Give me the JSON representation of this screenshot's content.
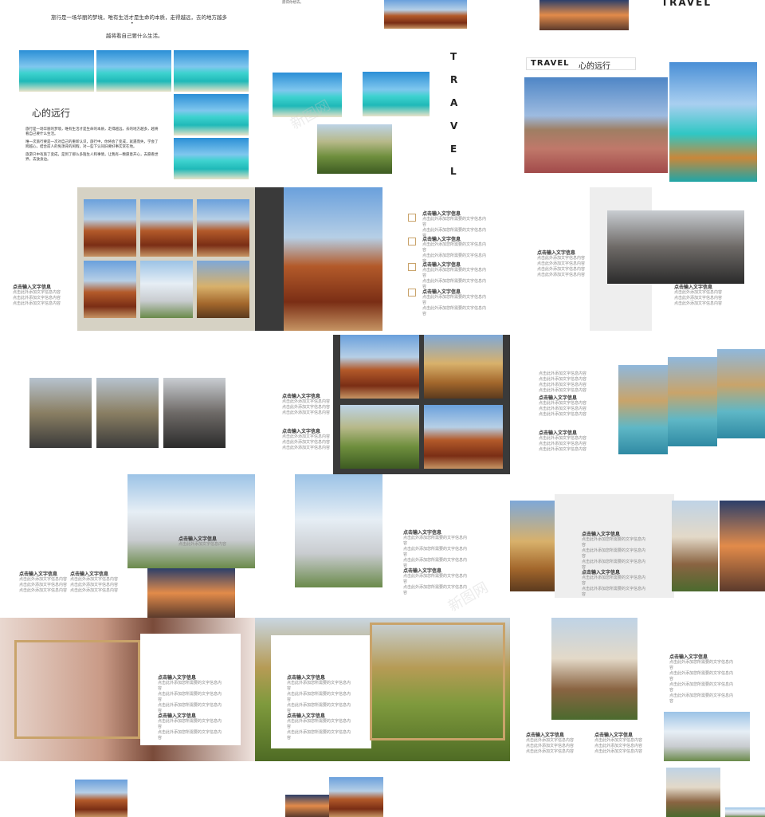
{
  "intro": {
    "line1": "旅行是一场华丽的梦境，唯有生活才是生命的本质，走得越远，去的地方越多",
    "bullet": "•",
    "line2": "越将看自己要什么生活。",
    "heading": "心的远行",
    "para1": "旅行是一场华丽的梦境，唯有生活才是生命的本质，走得越远，去的地方越多，越将看自己要什么生活。",
    "para2": "唯一次旅行要是一次对自己的重新认识，旅行中，你将会了变成，就遇而失，学会了跨越心，结合前人的免须背的闲暇，对一些下认同旧要好事实赏在地。",
    "para3": "旅游只中有旅了变成，是到了那么多陌生人和事情，让我有一颗愿意开心，去愿看世界，去放身边。"
  },
  "top_small_text": "愿得你想去。",
  "travel_word": "TRAVEL",
  "travel_vertical": [
    "T",
    "R",
    "A",
    "V",
    "E",
    "L"
  ],
  "travel_title": {
    "en": "TRAVEL",
    "zh": "心的远行"
  },
  "watermark": "新图网",
  "block": {
    "title": "点击输入文字信息",
    "body": "点击此外添加您所需要的文字信息内容"
  },
  "block_short": {
    "title": "点击输入文字信息",
    "body": "点击此外添加文字信息内容"
  },
  "icons": [
    "ico-1",
    "ico-2",
    "ico-3",
    "ico-4"
  ],
  "colors": {
    "accent_gold": "#c9a36a",
    "dark_panel": "#3a3a3a",
    "beige_panel": "#d6d2c4",
    "gray_panel": "#eeeeee"
  }
}
